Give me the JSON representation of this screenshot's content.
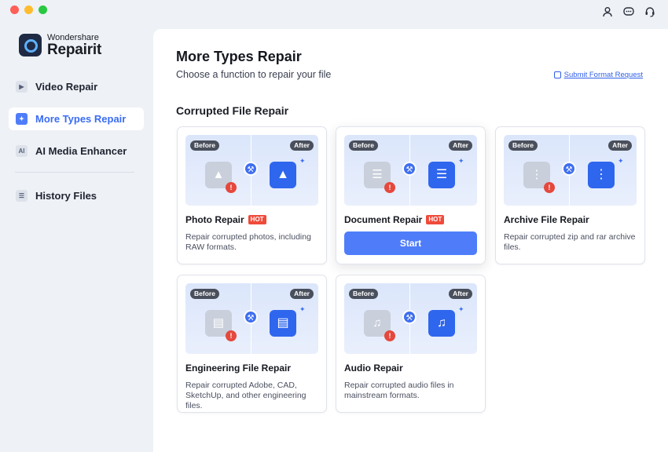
{
  "app": {
    "brand": "Wondershare",
    "product": "Repairit"
  },
  "sidebar": {
    "items": [
      {
        "label": "Video Repair",
        "icon": "play-icon"
      },
      {
        "label": "More Types Repair",
        "icon": "wrench-icon",
        "active": true
      },
      {
        "label": "AI Media Enhancer",
        "icon": "ai-icon",
        "icon_text": "AI"
      },
      {
        "label": "History Files",
        "icon": "list-icon"
      }
    ]
  },
  "header": {
    "title": "More Types Repair",
    "subtitle": "Choose a function to repair your file",
    "submit_link": "Submit Format Request"
  },
  "section": {
    "title": "Corrupted File Repair"
  },
  "thumb_labels": {
    "before": "Before",
    "after": "After"
  },
  "badge": {
    "hot": "HOT"
  },
  "cards": [
    {
      "title": "Photo Repair",
      "hot": true,
      "desc": "Repair corrupted photos, including RAW formats.",
      "icon": "photo-icon"
    },
    {
      "title": "Document Repair",
      "hot": true,
      "button": "Start",
      "icon": "document-icon"
    },
    {
      "title": "Archive File Repair",
      "hot": false,
      "desc": "Repair corrupted zip and rar archive files.",
      "icon": "archive-icon"
    },
    {
      "title": "Engineering File Repair",
      "hot": false,
      "desc": "Repair corrupted Adobe, CAD, SketchUp, and other engineering files.",
      "icon": "folder-icon"
    },
    {
      "title": "Audio Repair",
      "hot": false,
      "desc": "Repair corrupted audio files in mainstream formats.",
      "icon": "music-icon"
    }
  ],
  "colors": {
    "accent": "#4f7dfa",
    "hot": "#f04a3a",
    "error": "#e5483c"
  }
}
